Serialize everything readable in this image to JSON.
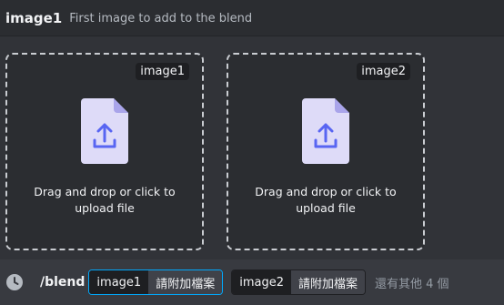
{
  "header": {
    "title": "image1",
    "description": "First image to add to the blend"
  },
  "dropzones": [
    {
      "label": "image1",
      "text": "Drag and drop or click to upload file",
      "icon": "file-upload-icon"
    },
    {
      "label": "image2",
      "text": "Drag and drop or click to upload file",
      "icon": "file-upload-icon"
    }
  ],
  "command_bar": {
    "icon": "clock-icon",
    "command": "/blend",
    "options": [
      {
        "name": "image1",
        "value": "請附加檔案",
        "active": true
      },
      {
        "name": "image2",
        "value": "請附加檔案",
        "active": false
      }
    ],
    "more_text": "還有其他 4 個"
  },
  "colors": {
    "accent": "#00a8fc",
    "icon_file": "#dedbf8",
    "icon_arrow": "#5865f2"
  }
}
